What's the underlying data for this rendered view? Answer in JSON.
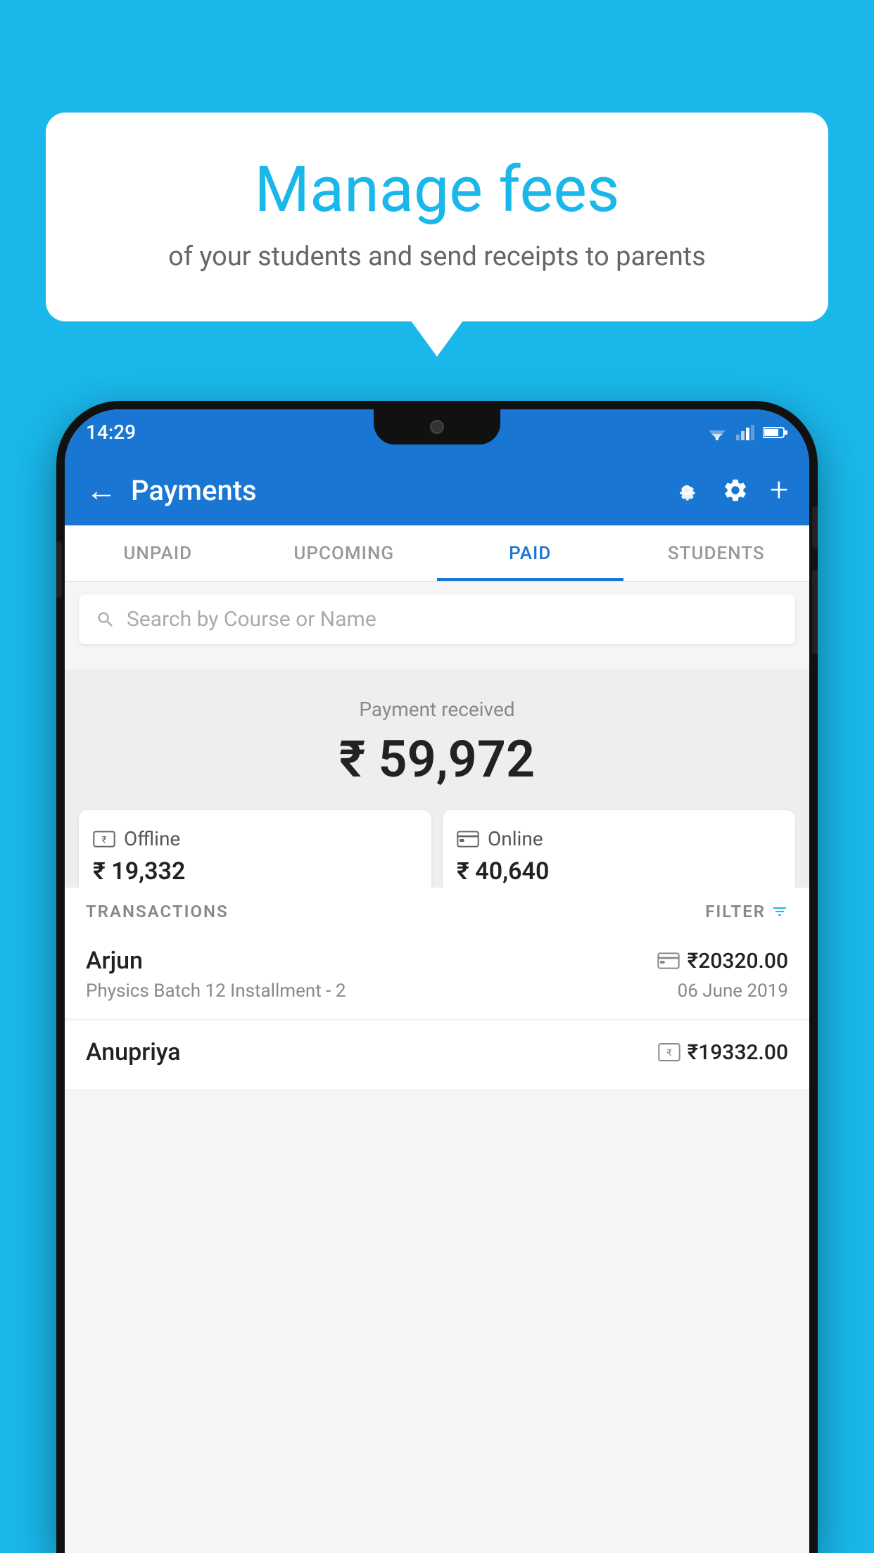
{
  "background_color": "#1AB7EA",
  "speech_bubble": {
    "title": "Manage fees",
    "subtitle": "of your students and send receipts to parents"
  },
  "status_bar": {
    "time": "14:29"
  },
  "header": {
    "title": "Payments",
    "back_label": "←",
    "settings_icon": "gear-icon",
    "add_icon": "plus-icon"
  },
  "tabs": [
    {
      "label": "UNPAID",
      "active": false
    },
    {
      "label": "UPCOMING",
      "active": false
    },
    {
      "label": "PAID",
      "active": true
    },
    {
      "label": "STUDENTS",
      "active": false
    }
  ],
  "search": {
    "placeholder": "Search by Course or Name"
  },
  "payment_summary": {
    "received_label": "Payment received",
    "amount": "₹ 59,972",
    "offline": {
      "label": "Offline",
      "amount": "₹ 19,332"
    },
    "online": {
      "label": "Online",
      "amount": "₹ 40,640"
    }
  },
  "transactions": {
    "section_label": "TRANSACTIONS",
    "filter_label": "FILTER",
    "rows": [
      {
        "name": "Arjun",
        "amount": "₹20320.00",
        "course": "Physics Batch 12 Installment - 2",
        "date": "06 June 2019",
        "payment_type": "card"
      },
      {
        "name": "Anupriya",
        "amount": "₹19332.00",
        "course": "",
        "date": "",
        "payment_type": "cash"
      }
    ]
  }
}
